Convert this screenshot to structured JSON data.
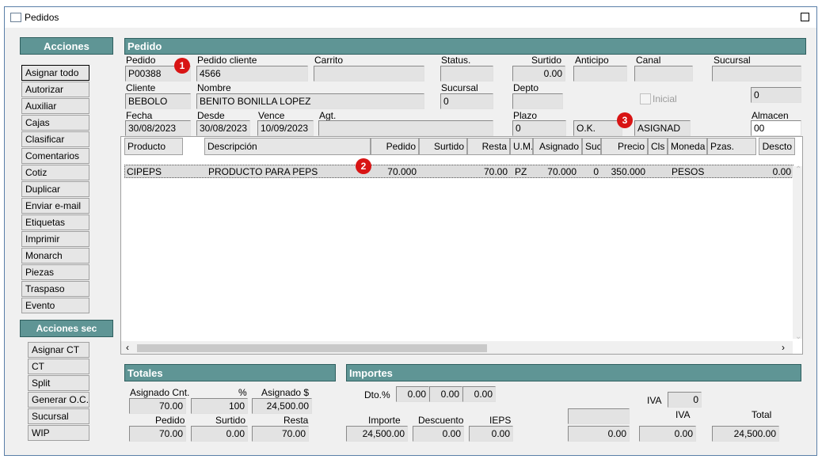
{
  "window": {
    "title": "Pedidos"
  },
  "sidebar": {
    "header": "Acciones",
    "items": [
      "Asignar todo",
      "Autorizar",
      "Auxiliar",
      "Cajas",
      "Clasificar",
      "Comentarios",
      "Cotiz",
      "Duplicar",
      "Enviar e-mail",
      "Etiquetas",
      "Imprimir",
      "Monarch",
      "Piezas",
      "Traspaso",
      "Evento"
    ],
    "sec_header": "Acciones sec",
    "sec_items": [
      "Asignar CT",
      "CT",
      "Split",
      "Generar O.C.",
      "Sucursal",
      "WIP"
    ]
  },
  "pedido": {
    "header": "Pedido",
    "labels": {
      "pedido": "Pedido",
      "pedido_cliente": "Pedido cliente",
      "carrito": "Carrito",
      "status": "Status.",
      "surtido": "Surtido",
      "anticipo": "Anticipo",
      "canal": "Canal",
      "sucursal": "Sucursal",
      "cliente": "Cliente",
      "nombre": "Nombre",
      "sucursal2": "Sucursal",
      "depto": "Depto",
      "inicial": "Inicial",
      "fecha": "Fecha",
      "desde": "Desde",
      "vence": "Vence",
      "agt": "Agt.",
      "plazo": "Plazo",
      "almacen": "Almacen"
    },
    "values": {
      "pedido": "P00388",
      "pedido_cliente": "4566",
      "carrito": "",
      "status": "",
      "surtido": "0.00",
      "anticipo": "",
      "canal": "",
      "sucursal": "",
      "cliente": "BEBOLO",
      "nombre": "BENITO BONILLA LOPEZ",
      "sucursal2": "0",
      "depto": "",
      "right_field": "0",
      "fecha": "30/08/2023",
      "desde": "30/08/2023",
      "vence": "10/09/2023",
      "agt": "",
      "plazo": "0",
      "ok": "O.K.",
      "asignad": "ASIGNAD",
      "almacen": "00"
    }
  },
  "badges": [
    "1",
    "2",
    "3"
  ],
  "table": {
    "columns": [
      "Producto",
      "Descripción",
      "Pedido",
      "Surtido",
      "Resta",
      "U.M.",
      "Asignado",
      "Suc",
      "Precio",
      "Cls",
      "Moneda",
      "Pzas.",
      "Descto"
    ],
    "rows": [
      {
        "producto": "CIPEPS",
        "descripcion": "PRODUCTO PARA PEPS",
        "pedido": "70.000",
        "surtido": "",
        "resta": "70.00",
        "um": "PZ",
        "asignado": "70.000",
        "suc": "0",
        "precio": "350.000",
        "cls": "",
        "moneda": "PESOS",
        "pzas": "",
        "descto": "0.00"
      }
    ]
  },
  "totales": {
    "header": "Totales",
    "labels": {
      "asignado_cnt": "Asignado Cnt.",
      "pct": "%",
      "asignado_s": "Asignado $",
      "pedido": "Pedido",
      "surtido": "Surtido",
      "resta": "Resta"
    },
    "values": {
      "asignado_cnt": "70.00",
      "pct": "100",
      "asignado_s": "24,500.00",
      "pedido": "70.00",
      "surtido": "0.00",
      "resta": "70.00"
    }
  },
  "importes": {
    "header": "Importes",
    "labels": {
      "dto": "Dto.%",
      "iva": "IVA",
      "importe": "Importe",
      "descuento": "Descuento",
      "ieps": "IEPS",
      "iva2": "IVA",
      "total": "Total"
    },
    "values": {
      "dto1": "0.00",
      "dto2": "0.00",
      "dto3": "0.00",
      "iva_pct": "0",
      "importe": "24,500.00",
      "descuento": "0.00",
      "ieps": "0.00",
      "blank": "",
      "extra": "0.00",
      "iva": "0.00",
      "total": "24,500.00"
    }
  }
}
